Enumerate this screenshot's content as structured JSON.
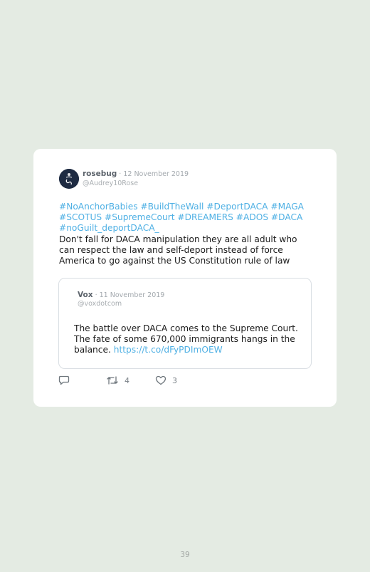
{
  "tweet": {
    "author_name": "rosebug",
    "separator": " · ",
    "date": "12 November 2019",
    "handle": "@Audrey10Rose",
    "hashtags": "#NoAnchorBabies #BuildTheWall #DeportDACA #MAGA #SCOTUS #SupremeCourt #DREAMERS #ADOS #DACA #noGuilt_deportDACA_",
    "text": "Don't fall for DACA manipulation they are all adult who can respect the law and self-deport instead of force America to go against the US Constitution rule of law",
    "icons": [
      "reply-icon",
      "retweet-icon",
      "like-icon"
    ],
    "retweets": "4",
    "likes": "3",
    "accent_color": "#4fb0e4"
  },
  "quoted": {
    "author_name": "Vox",
    "separator": " · ",
    "date": "11 November 2019",
    "handle": "@voxdotcom",
    "text": "The battle over DACA comes to the Supreme Court. The fate of some 670,000 immigrants hangs in the balance.",
    "link": "https://t.co/dFyPDImOEW"
  },
  "page_number": "39"
}
